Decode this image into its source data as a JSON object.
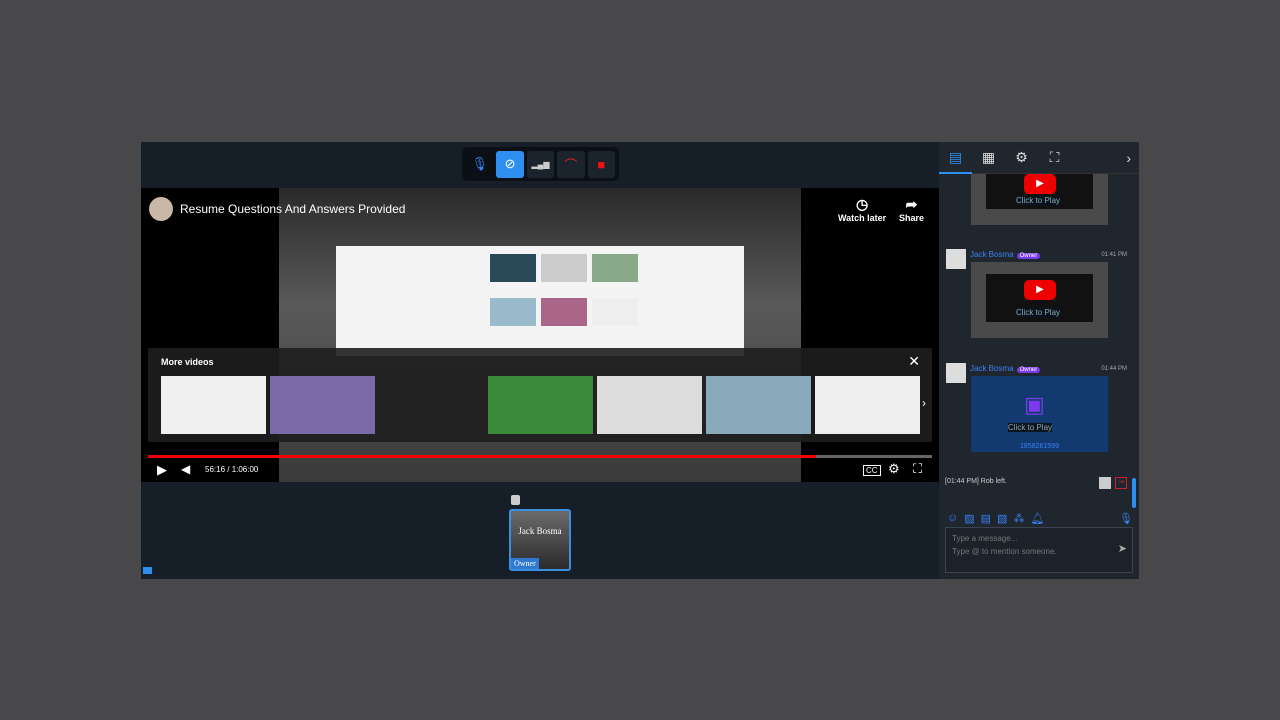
{
  "toolbar": {
    "buttons": [
      {
        "name": "microphone-icon",
        "glyph": "🎙"
      },
      {
        "name": "camera-off-icon",
        "glyph": "⊘"
      },
      {
        "name": "signal-icon",
        "glyph": "▂▄▆"
      },
      {
        "name": "hang-up-icon",
        "glyph": "☎"
      },
      {
        "name": "stop-icon",
        "glyph": "■"
      }
    ]
  },
  "video": {
    "title": "Resume Questions And Answers Provided",
    "watch_later": "Watch later",
    "share": "Share",
    "more_videos": "More videos",
    "time": "56:16 / 1:06:00",
    "progress": 0.852,
    "cc": "CC"
  },
  "participant": {
    "name": "Jack Bosma",
    "role": "Owner"
  },
  "sidebar": {
    "messages": [
      {
        "name": "Jack Bosma",
        "badge": "Owner",
        "time": "01:41 PM",
        "click": "Click to Play"
      },
      {
        "name": "Jack Bosma",
        "badge": "Owner",
        "time": "01:44 PM",
        "click": "Click to Play",
        "id": "1858261599"
      }
    ],
    "top_click": "Click to Play",
    "system": "[01:44 PM] Rob left.",
    "placeholder_1": "Type a message...",
    "placeholder_2": "Type @ to mention someone."
  },
  "colors": {
    "accent": "#2f8ff0",
    "owner_badge": "#7c3aed",
    "progress": "#ee0000"
  }
}
